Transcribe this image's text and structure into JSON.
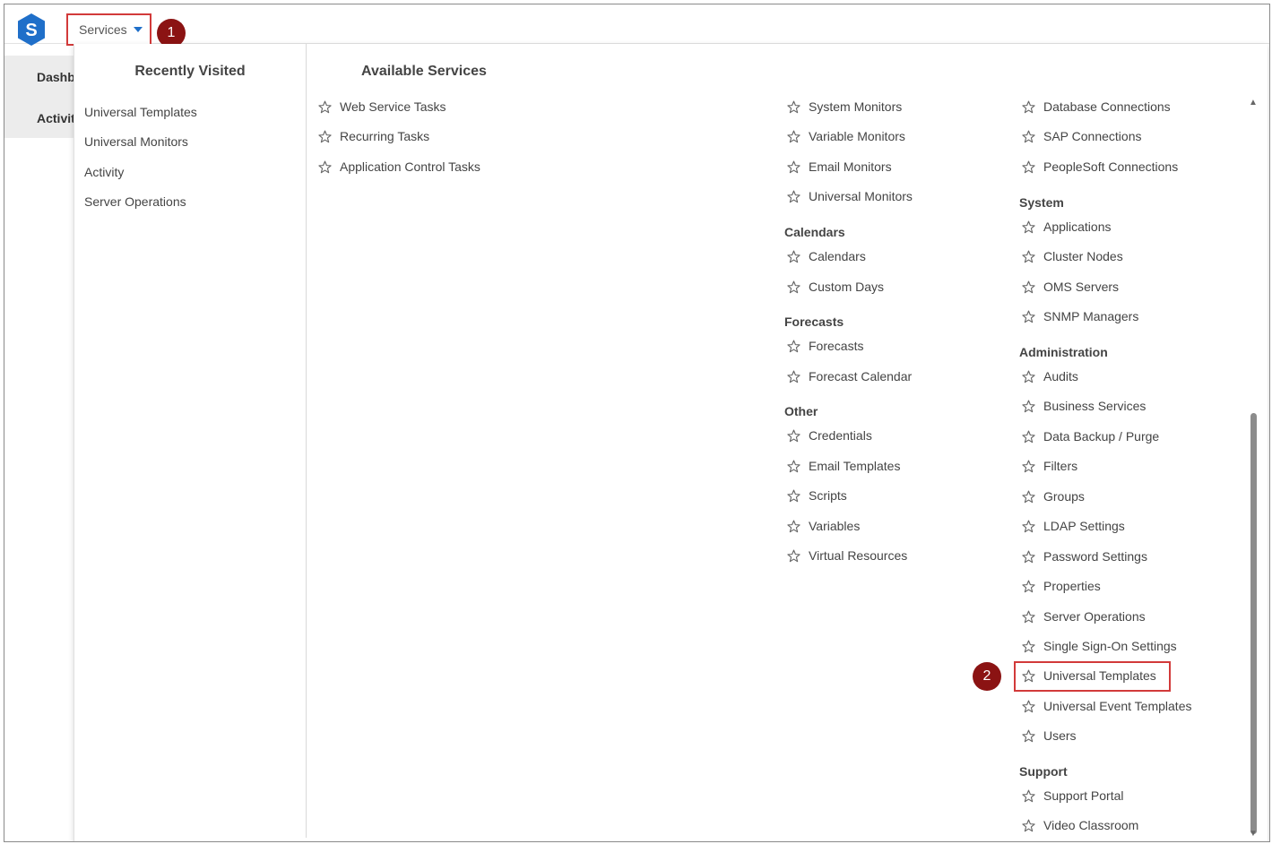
{
  "header": {
    "logo_letter": "S",
    "services_label": "Services",
    "callout_1": "1",
    "callout_2": "2"
  },
  "background_nav": [
    "Dashb",
    "Activit"
  ],
  "recently_visited": {
    "title": "Recently Visited",
    "items": [
      "Universal Templates",
      "Universal Monitors",
      "Activity",
      "Server Operations"
    ]
  },
  "available_services": {
    "title": "Available Services",
    "col1": [
      "Web Service Tasks",
      "Recurring Tasks",
      "Application Control Tasks"
    ],
    "col2_top": [
      "System Monitors",
      "Variable Monitors",
      "Email Monitors",
      "Universal Monitors"
    ],
    "calendars": {
      "heading": "Calendars",
      "items": [
        "Calendars",
        "Custom Days"
      ]
    },
    "forecasts": {
      "heading": "Forecasts",
      "items": [
        "Forecasts",
        "Forecast Calendar"
      ]
    },
    "other": {
      "heading": "Other",
      "items": [
        "Credentials",
        "Email Templates",
        "Scripts",
        "Variables",
        "Virtual Resources"
      ]
    },
    "col3_top": [
      "Database Connections",
      "SAP Connections",
      "PeopleSoft Connections"
    ],
    "system": {
      "heading": "System",
      "items": [
        "Applications",
        "Cluster Nodes",
        "OMS Servers",
        "SNMP Managers"
      ]
    },
    "administration": {
      "heading": "Administration",
      "items": [
        "Audits",
        "Business Services",
        "Data Backup / Purge",
        "Filters",
        "Groups",
        "LDAP Settings",
        "Password Settings",
        "Properties",
        "Server Operations",
        "Single Sign-On Settings",
        "Universal Templates",
        "Universal Event Templates",
        "Users"
      ]
    },
    "support": {
      "heading": "Support",
      "items": [
        "Support Portal",
        "Video Classroom"
      ]
    }
  },
  "colors": {
    "highlight_border": "#d23a3a",
    "callout_bg": "#8b1313",
    "logo_blue": "#1f6fc9"
  }
}
